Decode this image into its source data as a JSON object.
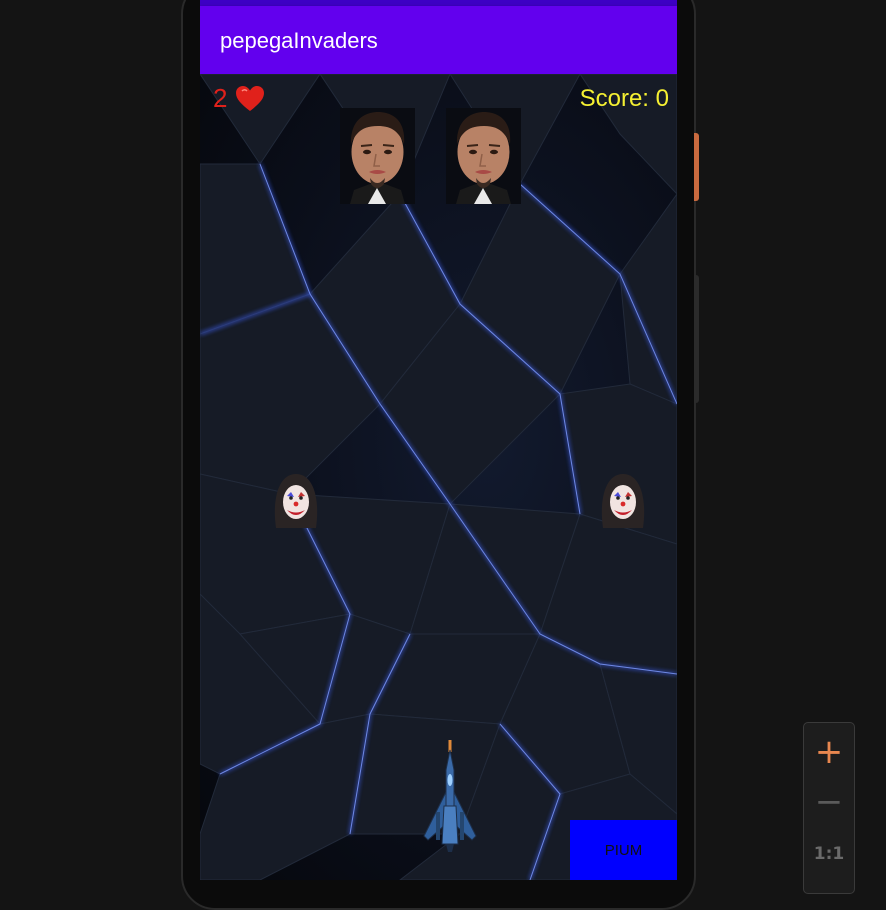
{
  "app": {
    "title": "pepegaInvaders"
  },
  "hud": {
    "lives": "2",
    "lives_icon": "heart-icon",
    "score_text": "Score: 0"
  },
  "controls": {
    "fire_label": "PIUM"
  },
  "zoom": {
    "plus": "+",
    "minus": "−",
    "reset": "1:1"
  },
  "sprites": {
    "enemy_large": "man-face-enemy",
    "enemy_small": "clown-face-enemy",
    "player": "spaceship-player"
  },
  "colors": {
    "appbar": "#6200ee",
    "status_strip": "#3d00c4",
    "lives_text": "#e0211b",
    "score_text": "#f5f032",
    "fire_button": "#0000ff",
    "zoom_accent": "#e8874f"
  }
}
